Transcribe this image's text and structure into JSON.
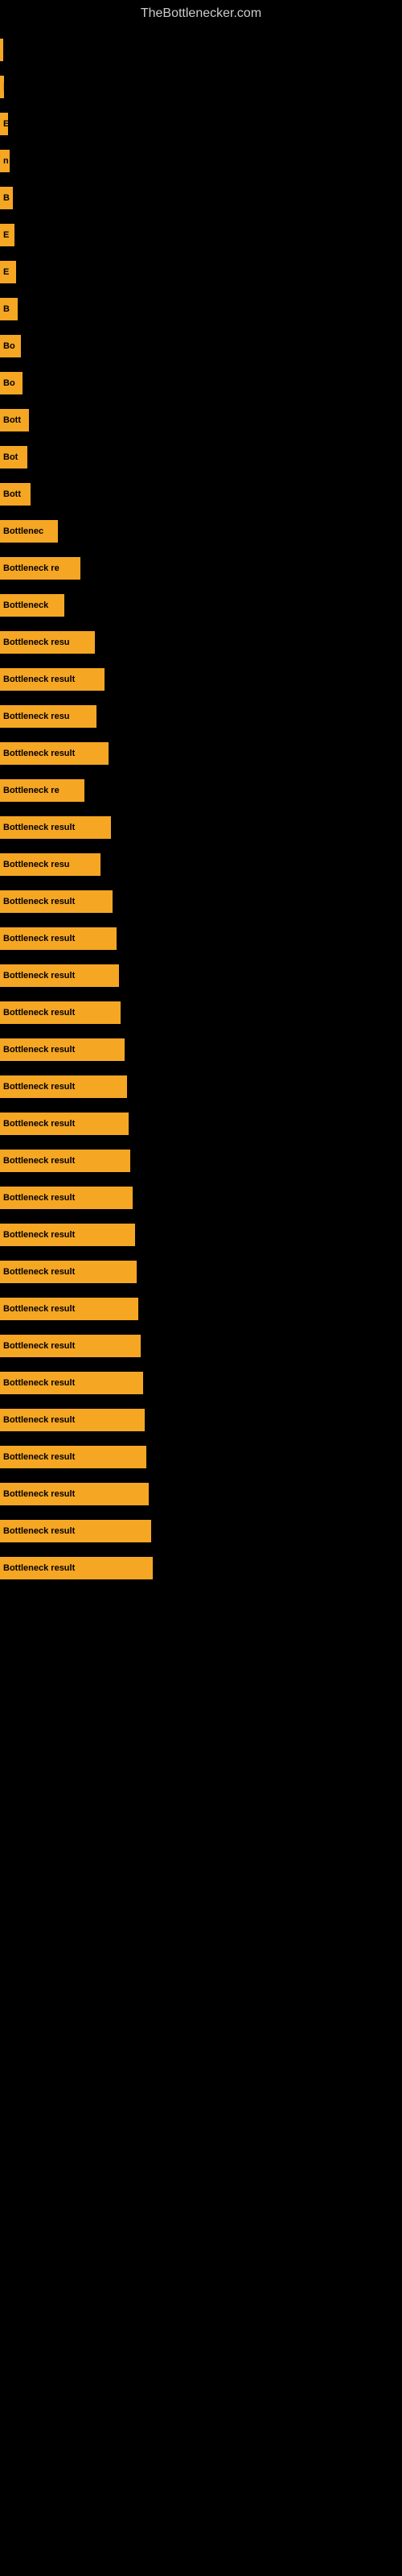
{
  "site": {
    "title": "TheBottlenecker.com"
  },
  "bars": [
    {
      "label": "|",
      "width": 4
    },
    {
      "label": "|",
      "width": 5
    },
    {
      "label": "E",
      "width": 10
    },
    {
      "label": "n",
      "width": 12
    },
    {
      "label": "B",
      "width": 16
    },
    {
      "label": "E",
      "width": 18
    },
    {
      "label": "E",
      "width": 20
    },
    {
      "label": "B",
      "width": 22
    },
    {
      "label": "Bo",
      "width": 26
    },
    {
      "label": "Bo",
      "width": 28
    },
    {
      "label": "Bott",
      "width": 36
    },
    {
      "label": "Bot",
      "width": 34
    },
    {
      "label": "Bott",
      "width": 38
    },
    {
      "label": "Bottlenec",
      "width": 72
    },
    {
      "label": "Bottleneck re",
      "width": 100
    },
    {
      "label": "Bottleneck",
      "width": 80
    },
    {
      "label": "Bottleneck resu",
      "width": 118
    },
    {
      "label": "Bottleneck result",
      "width": 130
    },
    {
      "label": "Bottleneck resu",
      "width": 120
    },
    {
      "label": "Bottleneck result",
      "width": 135
    },
    {
      "label": "Bottleneck re",
      "width": 105
    },
    {
      "label": "Bottleneck result",
      "width": 138
    },
    {
      "label": "Bottleneck resu",
      "width": 125
    },
    {
      "label": "Bottleneck result",
      "width": 140
    },
    {
      "label": "Bottleneck result",
      "width": 145
    },
    {
      "label": "Bottleneck result",
      "width": 148
    },
    {
      "label": "Bottleneck result",
      "width": 150
    },
    {
      "label": "Bottleneck result",
      "width": 155
    },
    {
      "label": "Bottleneck result",
      "width": 158
    },
    {
      "label": "Bottleneck result",
      "width": 160
    },
    {
      "label": "Bottleneck result",
      "width": 162
    },
    {
      "label": "Bottleneck result",
      "width": 165
    },
    {
      "label": "Bottleneck result",
      "width": 168
    },
    {
      "label": "Bottleneck result",
      "width": 170
    },
    {
      "label": "Bottleneck result",
      "width": 172
    },
    {
      "label": "Bottleneck result",
      "width": 175
    },
    {
      "label": "Bottleneck result",
      "width": 178
    },
    {
      "label": "Bottleneck result",
      "width": 180
    },
    {
      "label": "Bottleneck result",
      "width": 182
    },
    {
      "label": "Bottleneck result",
      "width": 185
    },
    {
      "label": "Bottleneck result",
      "width": 188
    },
    {
      "label": "Bottleneck result",
      "width": 190
    }
  ]
}
